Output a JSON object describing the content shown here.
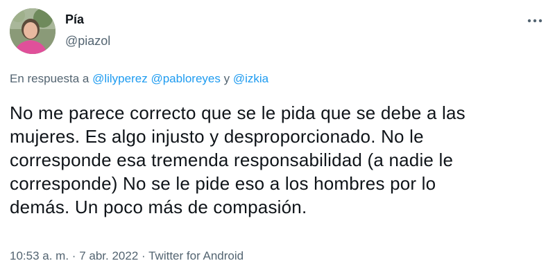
{
  "author": {
    "name": "Pía",
    "handle": "@piazol"
  },
  "reply": {
    "prefix": "En respuesta a",
    "mentions": [
      "@lilyperez",
      "@pabloreyes",
      "@izkia"
    ],
    "connector": "y"
  },
  "tweet": {
    "lines": [
      "No me parece correcto que se le pida que se debe a las",
      "mujeres. Es algo injusto y desproporcionado. No le",
      "corresponde esa tremenda responsabilidad (a nadie le",
      "corresponde) No se le pide eso a los hombres por lo",
      "demás. Un poco más de compasión."
    ]
  },
  "meta": {
    "time": "10:53 a. m.",
    "date": "7 abr. 2022",
    "source": "Twitter for Android",
    "separator": "·"
  },
  "icons": {
    "more": "more-horizontal-icon"
  },
  "colors": {
    "link": "#1d9bf0",
    "text_primary": "#0f1419",
    "text_secondary": "#536471"
  }
}
